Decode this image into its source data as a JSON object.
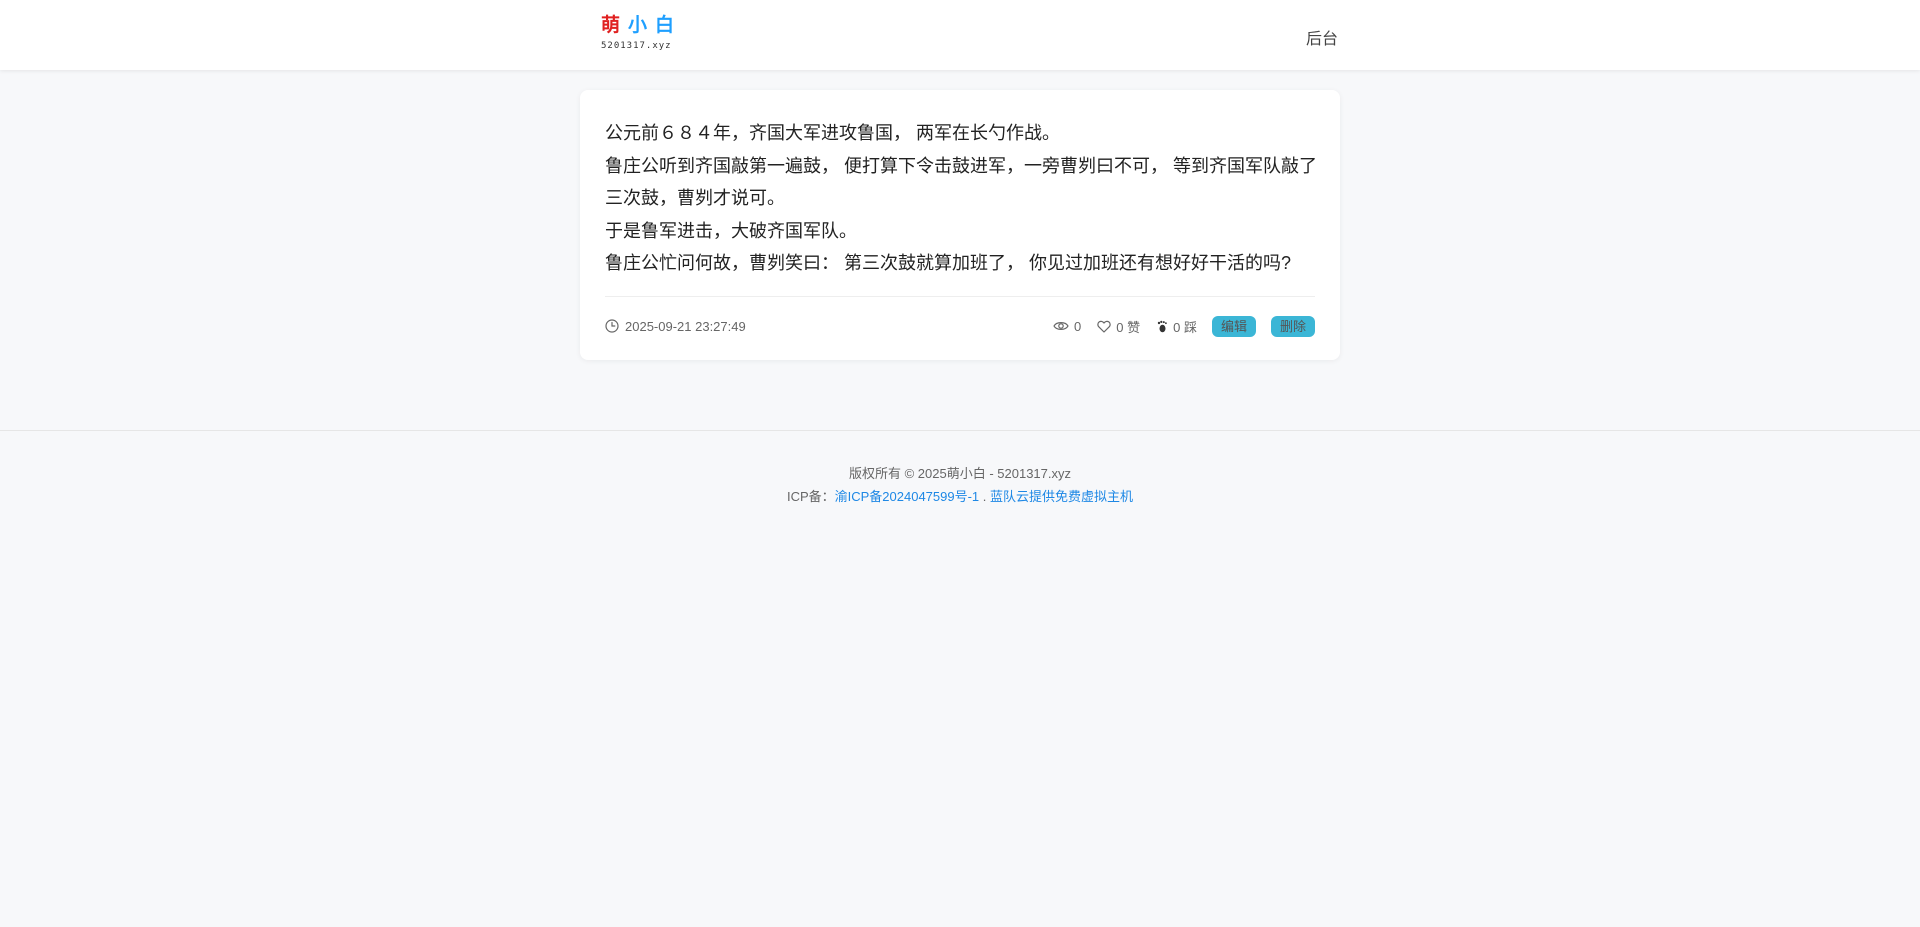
{
  "header": {
    "logo": {
      "char1": "萌",
      "char2": "小",
      "char3": "白",
      "domain": "5201317.xyz",
      "colors": {
        "char1": "#e02020",
        "char2": "#1e9fff",
        "char3": "#1e9fff"
      }
    },
    "nav_admin": "后台"
  },
  "post": {
    "lines": [
      " 公元前６８４年，齐国大军进攻鲁国， 两军在长勺作战。",
      "鲁庄公听到齐国敲第一遍鼓， 便打算下令击鼓进军，一旁曹刿曰不可， 等到齐国军队敲了三次鼓，曹刿才说可。",
      "于是鲁军进击，大破齐国军队。",
      "鲁庄公忙问何故，曹刿笑曰： 第三次鼓就算加班了， 你见过加班还有想好好干活的吗?"
    ],
    "date": "2025-09-21 23:27:49",
    "views": "0",
    "likes": "0 赞",
    "dislikes": "0 踩",
    "edit_label": "编辑",
    "delete_label": "删除",
    "button_color": "#3bb6d6"
  },
  "footer": {
    "copyright": "版权所有 © 2025萌小白 - 5201317.xyz",
    "icp_prefix": "ICP备：",
    "icp_link": "渝ICP备2024047599号-1",
    "separator": ".",
    "host_link": "蓝队云提供免费虚拟主机",
    "link_color": "#1e88e5"
  }
}
